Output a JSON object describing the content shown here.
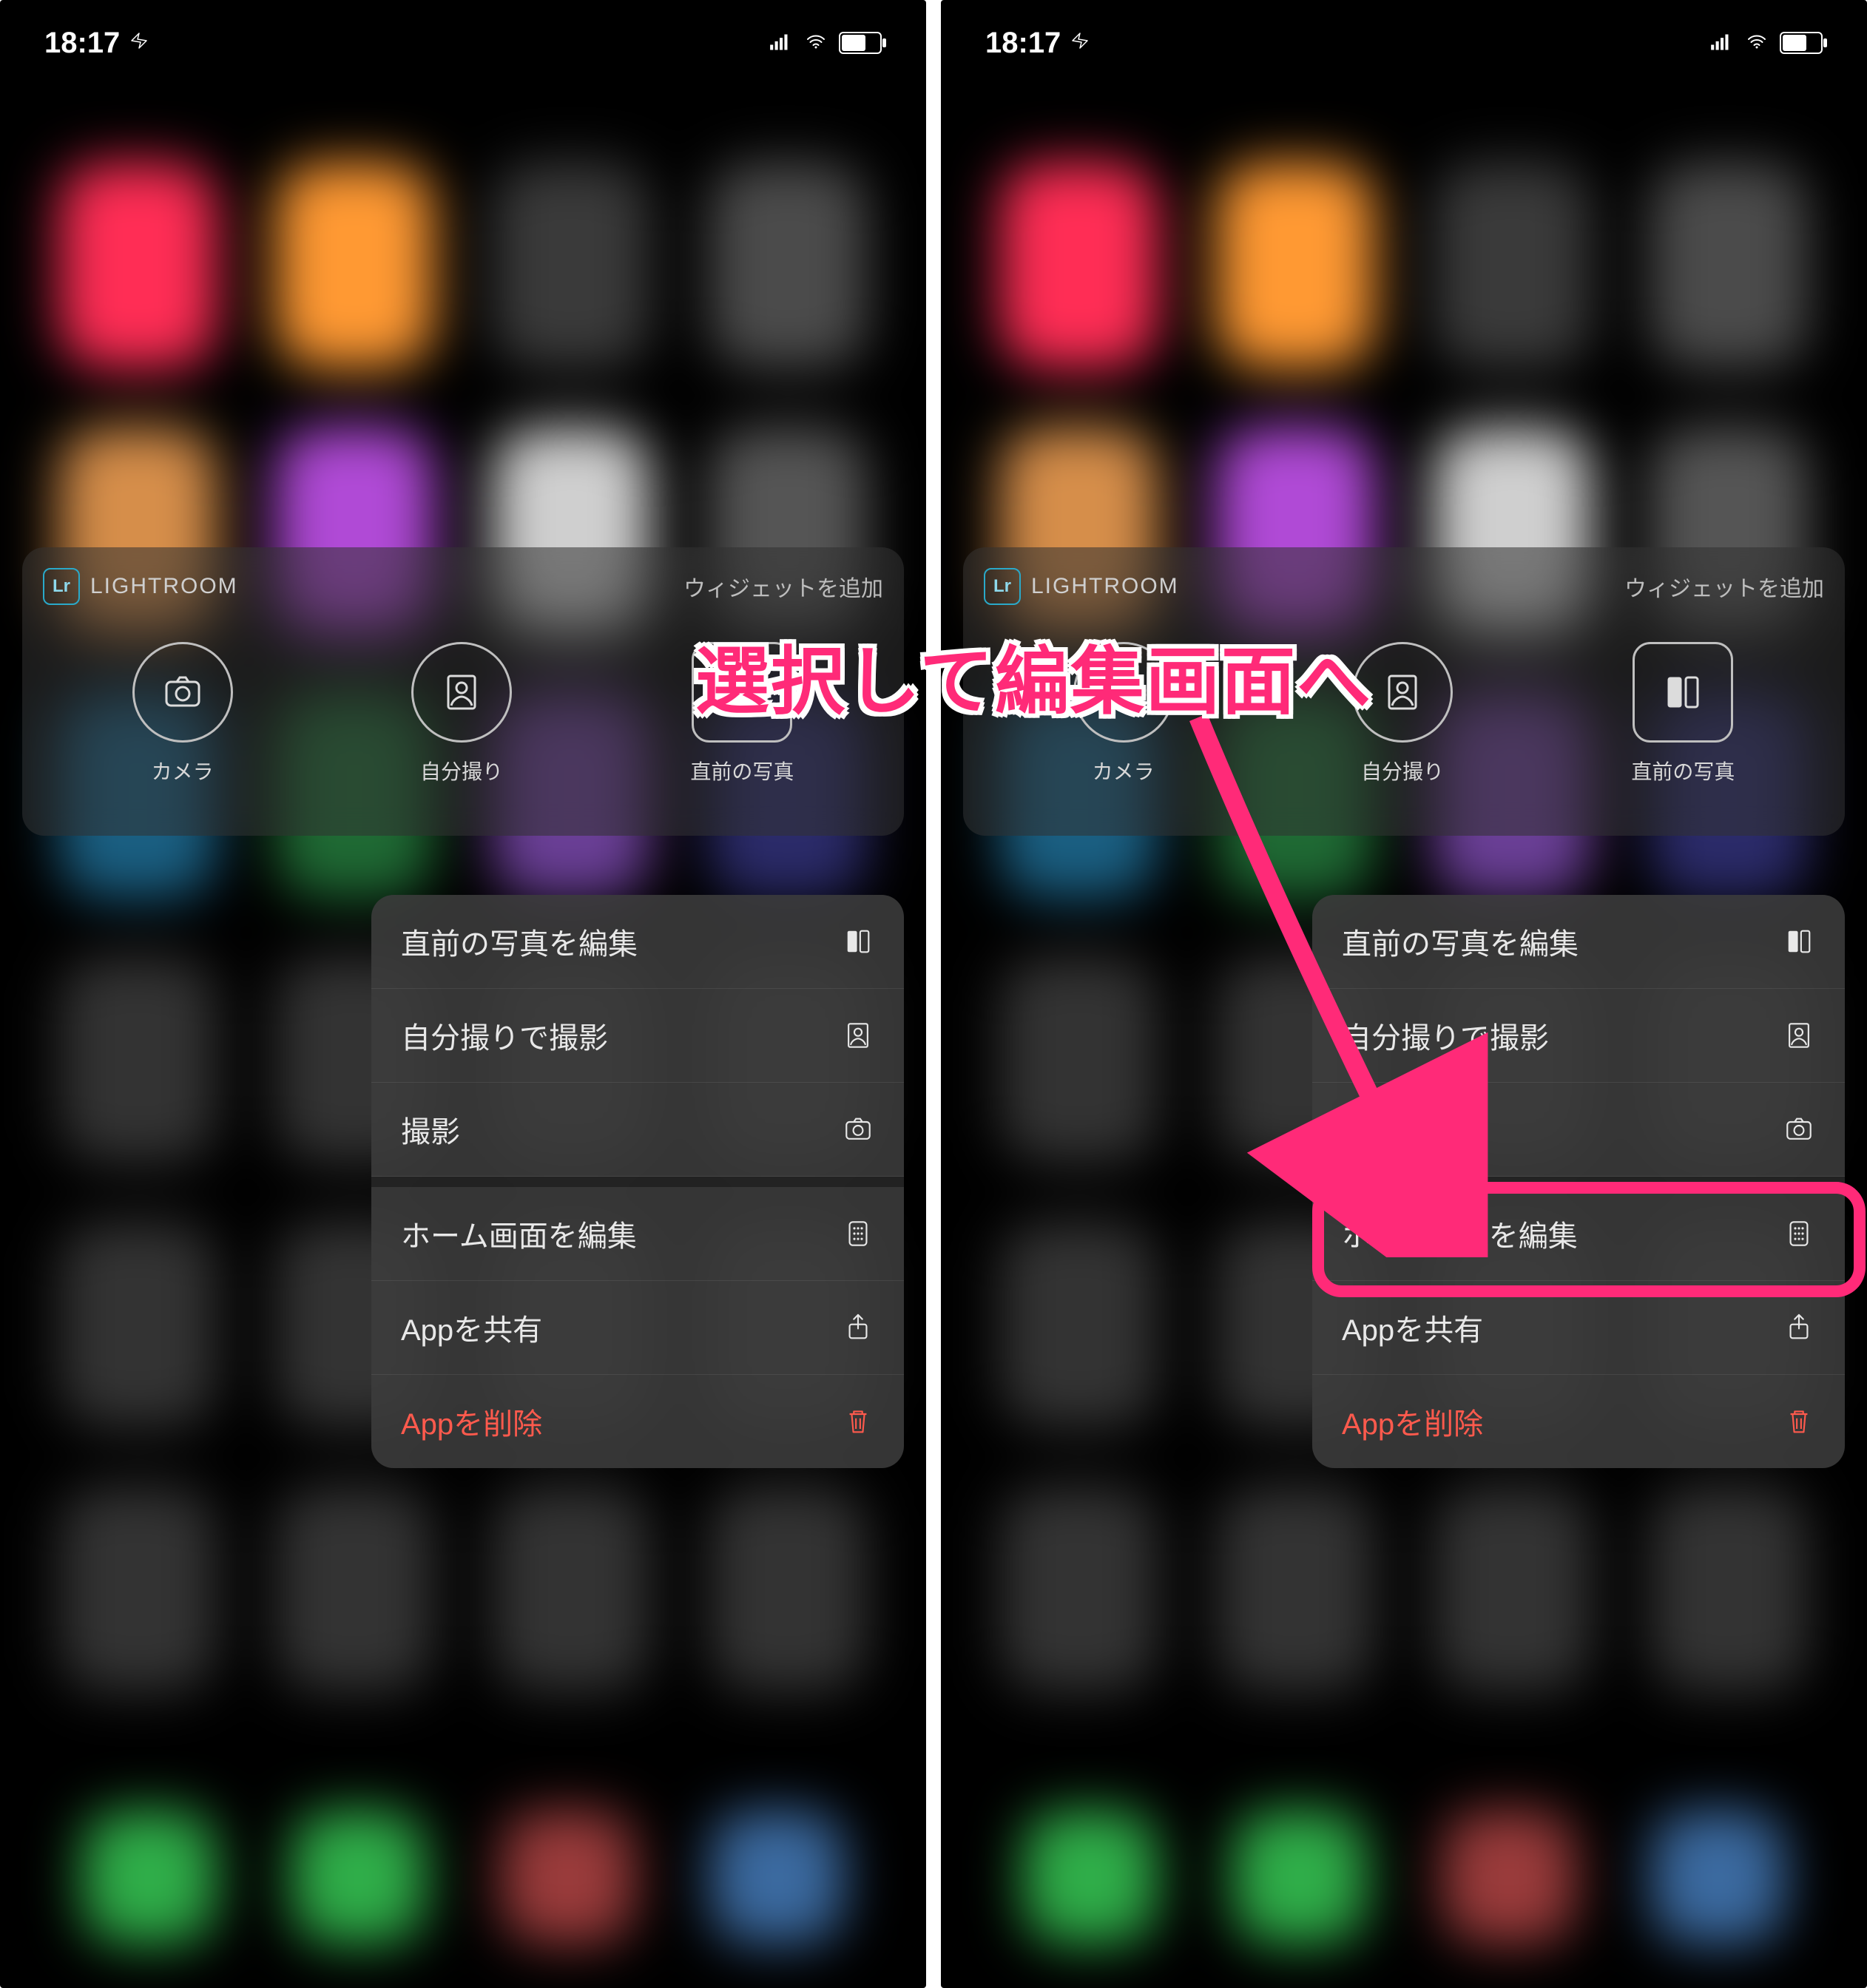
{
  "status": {
    "time": "18:17"
  },
  "widget": {
    "badge": "Lr",
    "title": "LIGHTROOM",
    "add_label": "ウィジェットを追加",
    "actions": [
      {
        "label": "カメラ",
        "icon": "camera"
      },
      {
        "label": "自分撮り",
        "icon": "portrait"
      },
      {
        "label": "直前の写真",
        "icon": "lr-rect"
      }
    ]
  },
  "menu": {
    "items": [
      {
        "label": "直前の写真を編集",
        "icon": "lr-rect",
        "type": "normal"
      },
      {
        "label": "自分撮りで撮影",
        "icon": "portrait",
        "type": "normal"
      },
      {
        "label": "撮影",
        "icon": "camera",
        "type": "normal"
      },
      {
        "label": "ホーム画面を編集",
        "icon": "apps",
        "type": "gap"
      },
      {
        "label": "Appを共有",
        "icon": "share",
        "type": "normal"
      },
      {
        "label": "Appを削除",
        "icon": "trash",
        "type": "delete"
      }
    ]
  },
  "annotation": {
    "text": "選択して編集画面へ"
  },
  "bg_colors": [
    "#ff2d55",
    "#ff9933",
    "#3a3a3a",
    "#4b4b4b",
    "#d68e4a",
    "#b04ad6",
    "#cfcfcf",
    "#555",
    "#1a5f82",
    "#1f6a34",
    "#6a3f96",
    "#2b2b6a",
    "#333",
    "#333",
    "#333",
    "#333",
    "#333",
    "#333",
    "#333",
    "#333",
    "#333",
    "#333",
    "#333",
    "#333"
  ],
  "dock_colors": [
    "#2fae49",
    "#2fae49",
    "#9a3b3b",
    "#3b6aa0"
  ]
}
